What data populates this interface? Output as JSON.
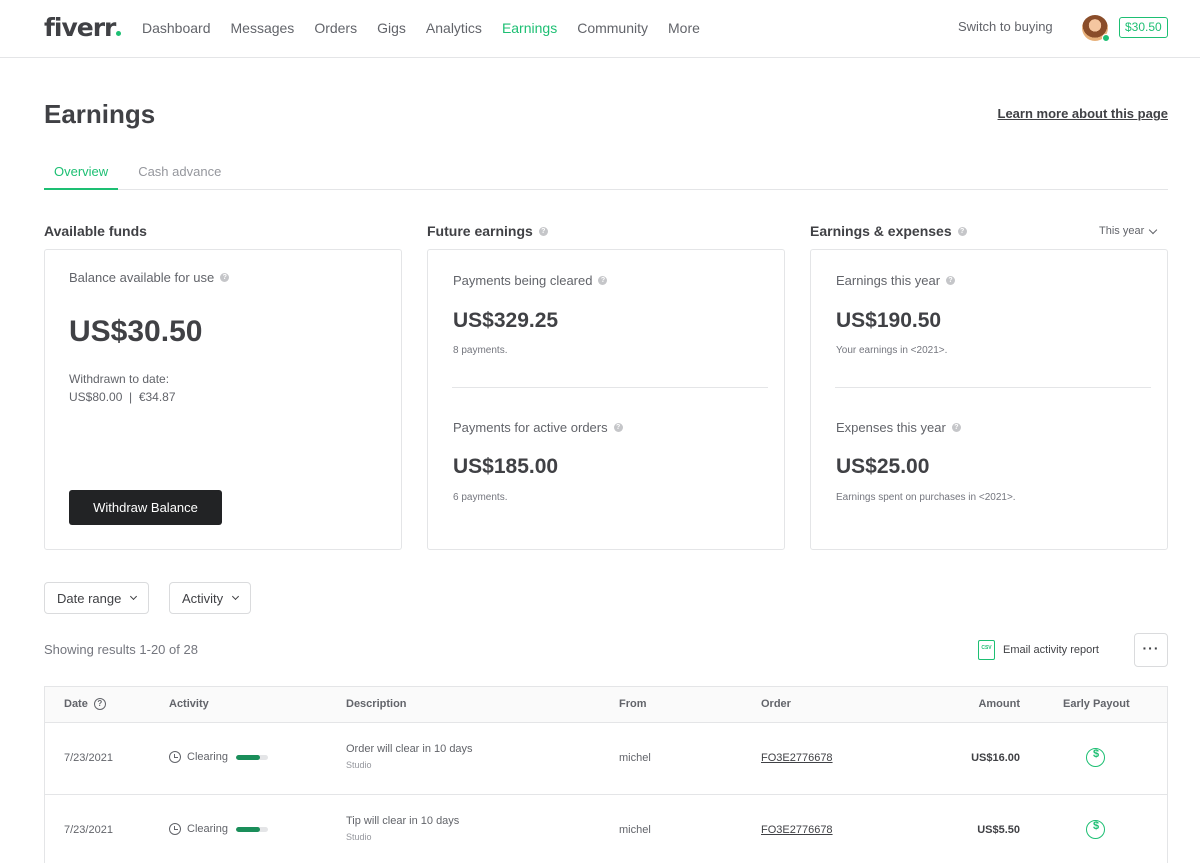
{
  "topbar": {
    "logo": "fiverr",
    "nav": [
      {
        "label": "Dashboard",
        "active": false
      },
      {
        "label": "Messages",
        "active": false
      },
      {
        "label": "Orders",
        "active": false
      },
      {
        "label": "Gigs",
        "active": false
      },
      {
        "label": "Analytics",
        "active": false
      },
      {
        "label": "Earnings",
        "active": true
      },
      {
        "label": "Community",
        "active": false
      },
      {
        "label": "More",
        "active": false
      }
    ],
    "switch_label": "Switch to buying",
    "balance": "$30.50"
  },
  "header": {
    "title": "Earnings",
    "learn_more": "Learn more about this page",
    "tabs": [
      "Overview",
      "Cash advance"
    ]
  },
  "sections": {
    "available": "Available funds",
    "future": "Future earnings",
    "expenses": "Earnings & expenses",
    "period": "This year"
  },
  "available": {
    "label": "Balance available for use",
    "amount": "US$30.50",
    "withdrawn_label": "Withdrawn to date:",
    "withdrawn_values": "US$80.00  |  €34.87",
    "button": "Withdraw Balance"
  },
  "future": {
    "cleared_label": "Payments being cleared",
    "cleared_amount": "US$329.25",
    "cleared_note": "8 payments.",
    "active_label": "Payments for active orders",
    "active_amount": "US$185.00",
    "active_note": "6 payments."
  },
  "earnings": {
    "year_label": "Earnings this year",
    "year_amount": "US$190.50",
    "year_note": "Your earnings in <2021>.",
    "exp_label": "Expenses this year",
    "exp_amount": "US$25.00",
    "exp_note": "Earnings spent on purchases in <2021>."
  },
  "filters": {
    "date_range": "Date range",
    "activity": "Activity"
  },
  "results": "Showing results 1-20 of 28",
  "email_report": "Email activity report",
  "table": {
    "headers": {
      "date": "Date",
      "activity": "Activity",
      "description": "Description",
      "from": "From",
      "order": "Order",
      "amount": "Amount",
      "early_payout": "Early Payout"
    },
    "rows": [
      {
        "date": "7/23/2021",
        "activity": "Clearing",
        "progress": 0.75,
        "description": "Order will clear in 10 days",
        "sub": "Studio",
        "from": "michel",
        "order": "FO3E2776678",
        "amount": "US$16.00"
      },
      {
        "date": "7/23/2021",
        "activity": "Clearing",
        "progress": 0.75,
        "description": "Tip will clear in 10 days",
        "sub": "Studio",
        "from": "michel",
        "order": "FO3E2776678",
        "amount": "US$5.50"
      }
    ]
  },
  "colors": {
    "accent": "#1dbf73",
    "dark_button": "#222325"
  }
}
